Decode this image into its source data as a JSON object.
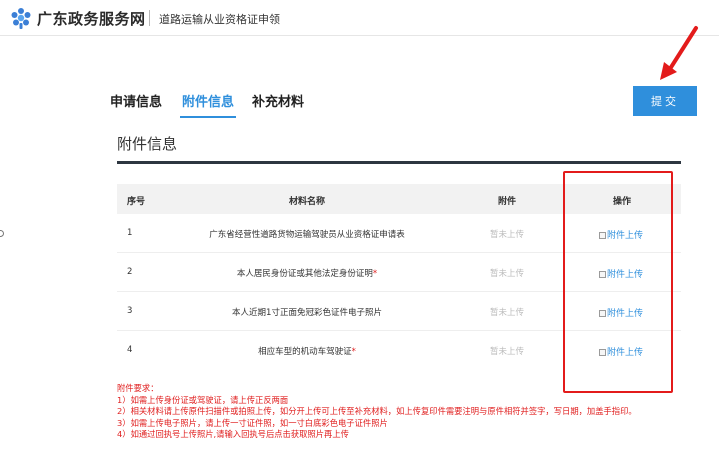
{
  "header": {
    "site_name": "广东政务服务网",
    "page_subtitle": "道路运输从业资格证申领",
    "logo_icon": "guangdong-gov-logo-icon"
  },
  "tabs": [
    {
      "label": "申请信息",
      "active": false
    },
    {
      "label": "附件信息",
      "active": true
    },
    {
      "label": "补充材料",
      "active": false
    }
  ],
  "submit_label": "提交",
  "section_title": "附件信息",
  "table": {
    "headers": {
      "no": "序号",
      "name": "材料名称",
      "file": "附件",
      "op": "操作"
    },
    "rows": [
      {
        "no": "1",
        "name": "广东省经营性道路货物运输驾驶员从业资格证申请表",
        "required": false,
        "file": "暂未上传",
        "op": "附件上传"
      },
      {
        "no": "2",
        "name": "本人居民身份证或其他法定身份证明",
        "required": true,
        "file": "暂未上传",
        "op": "附件上传"
      },
      {
        "no": "3",
        "name": "本人近期1寸正面免冠彩色证件电子照片",
        "required": false,
        "file": "暂未上传",
        "op": "附件上传"
      },
      {
        "no": "4",
        "name": "相应车型的机动车驾驶证",
        "required": true,
        "file": "暂未上传",
        "op": "附件上传"
      }
    ],
    "required_mark": "*"
  },
  "notes": {
    "title": "附件要求：",
    "items": [
      "1）如需上传身份证或驾驶证，请上传正反两面",
      "2）相关材料请上传原件扫描件或拍照上传，如分开上传可上传至补充材料，如上传复印件需要注明与原件相符并签字，写日期，加盖手指印。",
      "3）如需上传电子照片，请上传一寸证件照，如一寸白底彩色电子证件照片",
      "4）如通过回执号上传照片,请输入回执号后点击获取照片再上传"
    ]
  },
  "colors": {
    "accent": "#2f8fdc",
    "annotation_red": "#e31b1b",
    "notes_red": "#e02020"
  }
}
